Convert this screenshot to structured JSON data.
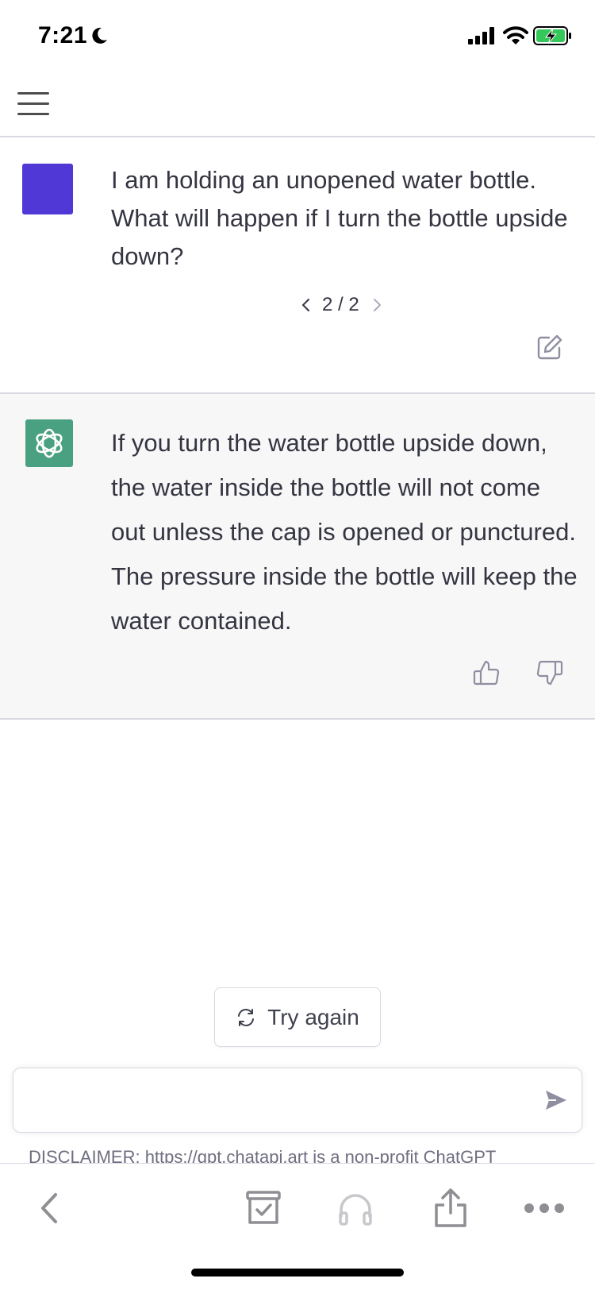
{
  "status_bar": {
    "time": "7:21",
    "icons": [
      "moon-icon",
      "cellular-signal-icon",
      "wifi-icon",
      "battery-charging-icon"
    ]
  },
  "header": {
    "menu_icon": "hamburger-menu-icon"
  },
  "conversation": {
    "user_message": {
      "text": "I am holding an unopened water bottle. What will happen if I turn the bottle upside down?",
      "pager": "2 / 2",
      "edit_icon": "edit-icon"
    },
    "assistant_message": {
      "text": "If you turn the water bottle upside down, the water inside the bottle will not come out unless the cap is opened or punctured. The pressure inside the bottle will keep the water contained.",
      "feedback_icons": [
        "thumbs-up-icon",
        "thumbs-down-icon"
      ]
    }
  },
  "actions": {
    "try_again_label": "Try again"
  },
  "composer": {
    "value": "",
    "placeholder": "",
    "send_icon": "send-icon"
  },
  "disclaimer": "DISCLAIMER: https://gpt.chatapi.art is a non-profit ChatGPT",
  "browser_toolbar": {
    "icons": [
      "back-icon",
      "archive-icon",
      "headphones-icon",
      "share-icon",
      "more-icon"
    ]
  },
  "colors": {
    "user_avatar": "#4f38d6",
    "assistant_avatar": "#4aa181",
    "assistant_bg": "#f7f7f8",
    "text": "#343541",
    "border": "#d9d9e3"
  }
}
